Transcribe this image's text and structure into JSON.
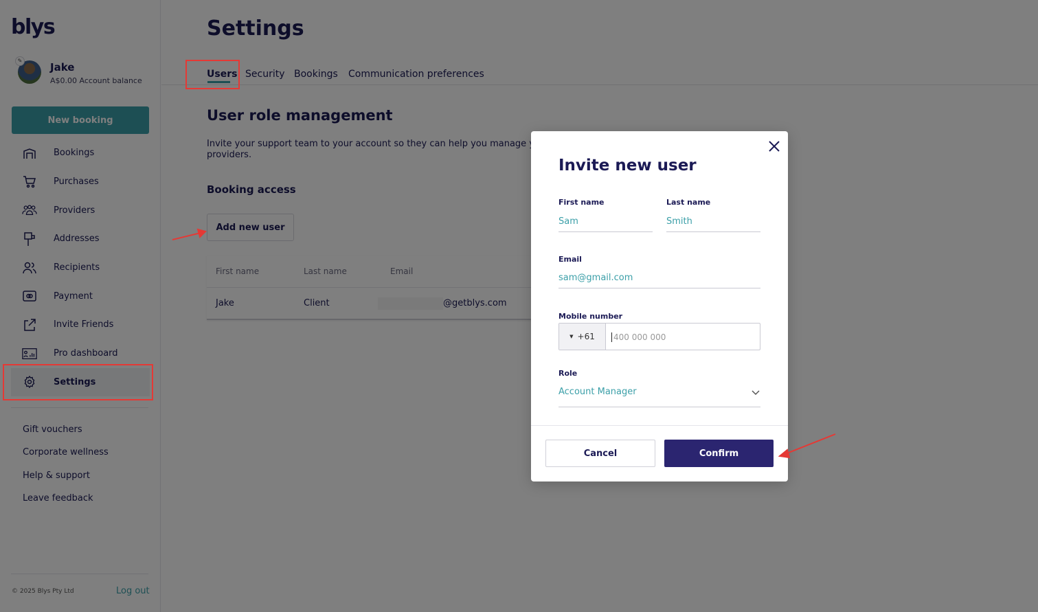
{
  "brand": {
    "logo": "blys",
    "accent": "#3b9fa8",
    "primary": "#2b2570"
  },
  "profile": {
    "name": "Jake",
    "balance": "A$0.00 Account balance"
  },
  "sidebar": {
    "new_booking_label": "New booking",
    "items": [
      {
        "label": "Bookings",
        "icon": "bookings-icon"
      },
      {
        "label": "Purchases",
        "icon": "cart-icon"
      },
      {
        "label": "Providers",
        "icon": "people-group-icon"
      },
      {
        "label": "Addresses",
        "icon": "mailbox-icon"
      },
      {
        "label": "Recipients",
        "icon": "users-icon"
      },
      {
        "label": "Payment",
        "icon": "payment-card-icon"
      },
      {
        "label": "Invite Friends",
        "icon": "share-icon"
      },
      {
        "label": "Pro dashboard",
        "icon": "dashboard-icon"
      },
      {
        "label": "Settings",
        "icon": "gear-icon",
        "active": true
      }
    ],
    "links": [
      "Gift vouchers",
      "Corporate wellness",
      "Help & support",
      "Leave feedback"
    ],
    "copyright": "© 2025 Blys Pty Ltd",
    "logout": "Log out"
  },
  "page": {
    "title": "Settings",
    "tabs": [
      "Users",
      "Security",
      "Bookings",
      "Communication preferences"
    ],
    "active_tab": "Users",
    "section_title": "User role management",
    "section_desc": "Invite your support team to your account so they can help you manage you",
    "section_desc_2": "providers.",
    "booking_access": "Booking access",
    "add_user_label": "Add new user",
    "table": {
      "headers": [
        "First name",
        "Last name",
        "Email"
      ],
      "rows": [
        {
          "first": "Jake",
          "last": "Client",
          "email": "@getblys.com"
        }
      ]
    }
  },
  "modal": {
    "title": "Invite new user",
    "first_name_label": "First name",
    "first_name_value": "Sam",
    "last_name_label": "Last name",
    "last_name_value": "Smith",
    "email_label": "Email",
    "email_value": "sam@gmail.com",
    "mobile_label": "Mobile number",
    "country_code": "+61",
    "mobile_placeholder": "400 000 000",
    "role_label": "Role",
    "role_value": "Account Manager",
    "cancel_label": "Cancel",
    "confirm_label": "Confirm"
  }
}
